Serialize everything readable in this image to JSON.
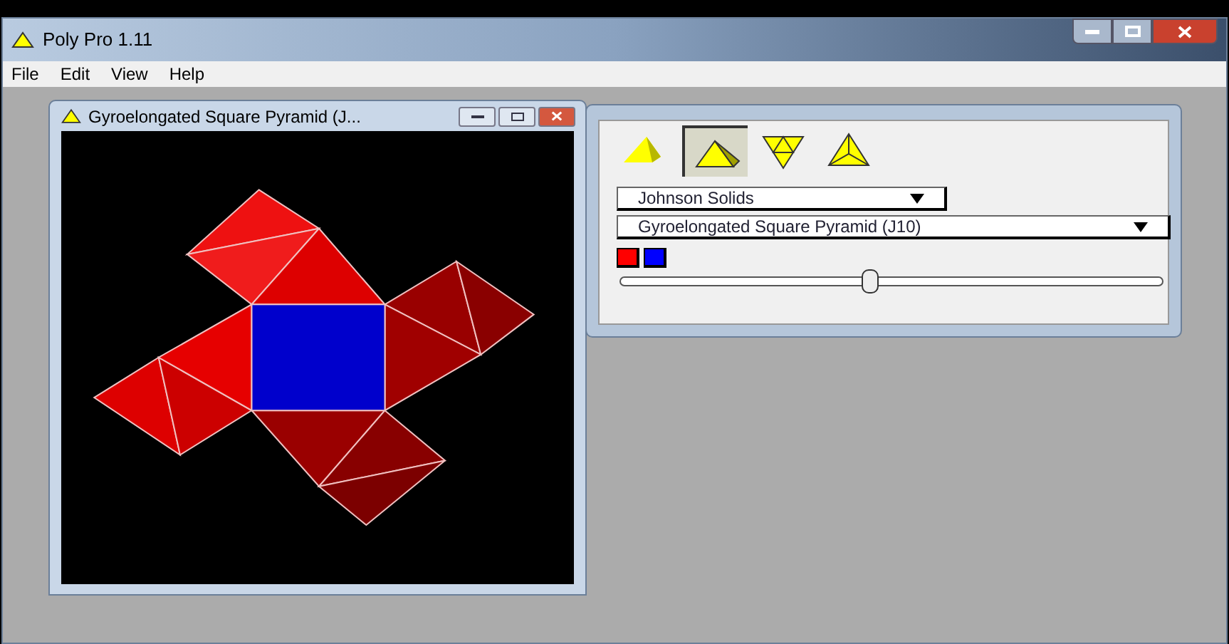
{
  "window": {
    "title": "Poly Pro 1.11"
  },
  "menu": [
    "File",
    "Edit",
    "View",
    "Help"
  ],
  "child_window": {
    "title": "Gyroelongated Square Pyramid (J..."
  },
  "tool_panel": {
    "view_buttons": [
      {
        "kind": "solid",
        "selected": false
      },
      {
        "kind": "pyramid",
        "selected": true
      },
      {
        "kind": "net",
        "selected": false
      },
      {
        "kind": "wire",
        "selected": false
      }
    ],
    "category": "Johnson Solids",
    "solid": "Gyroelongated Square Pyramid (J10)",
    "swatches": [
      {
        "color": "#ff0000"
      },
      {
        "color": "#0000ff"
      }
    ],
    "slider": {
      "level": 0.46
    }
  }
}
